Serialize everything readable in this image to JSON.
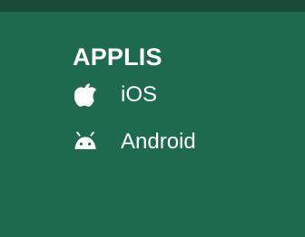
{
  "section": {
    "title": "APPLIS"
  },
  "links": [
    {
      "label": "iOS",
      "icon": "apple-icon"
    },
    {
      "label": "Android",
      "icon": "android-icon"
    }
  ],
  "colors": {
    "background": "#1e6a4d",
    "top_bar": "#174b38",
    "text": "#ffffff"
  }
}
